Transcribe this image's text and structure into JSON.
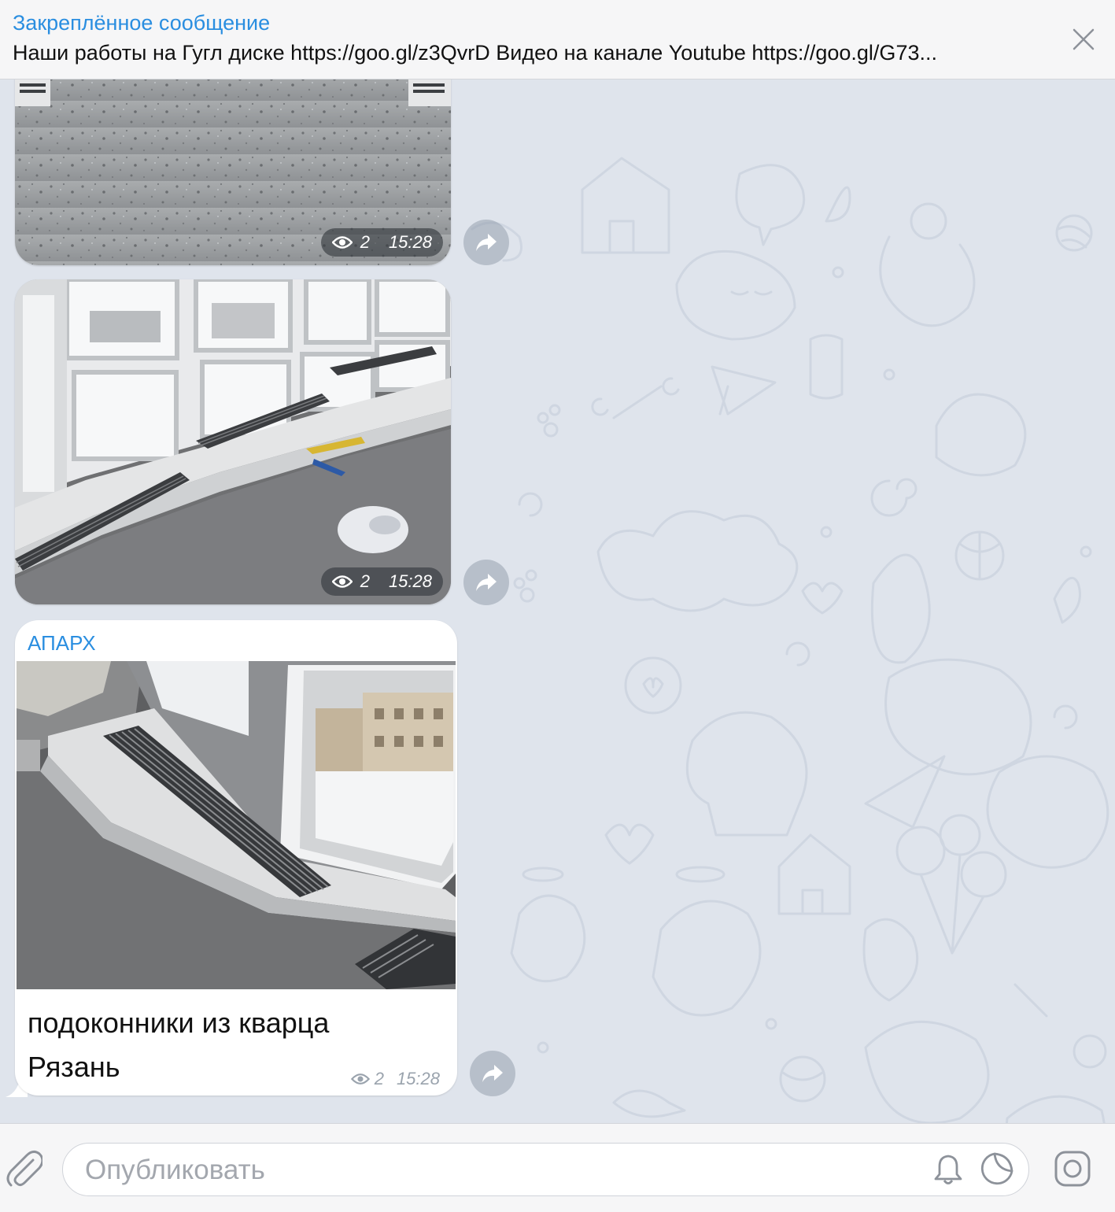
{
  "pinned": {
    "title": "Закреплённое сообщение",
    "text": "Наши работы на Гугл диске https://goo.gl/z3QvrD Видео на канале Youtube https://goo.gl/G73..."
  },
  "messages": [
    {
      "type": "photo",
      "views": "2",
      "time": "15:28"
    },
    {
      "type": "photo",
      "views": "2",
      "time": "15:28"
    },
    {
      "type": "post",
      "author": "АПАРХ",
      "text_line1": "подоконники из кварца",
      "text_line2": "Рязань",
      "views": "2",
      "time": "15:28"
    }
  ],
  "composer": {
    "placeholder": "Опубликовать"
  },
  "icons": {
    "close": "close-icon",
    "views": "eye-icon",
    "share": "share-arrow-icon",
    "attach": "paperclip-icon",
    "notifications": "bell-icon",
    "stickers": "sticker-icon",
    "instant_video": "camera-square-icon"
  },
  "colors": {
    "accent": "#2a8ee0",
    "chat_background": "#dfe4ec",
    "bubble": "#ffffff",
    "meta_muted": "#9aa3ad"
  }
}
